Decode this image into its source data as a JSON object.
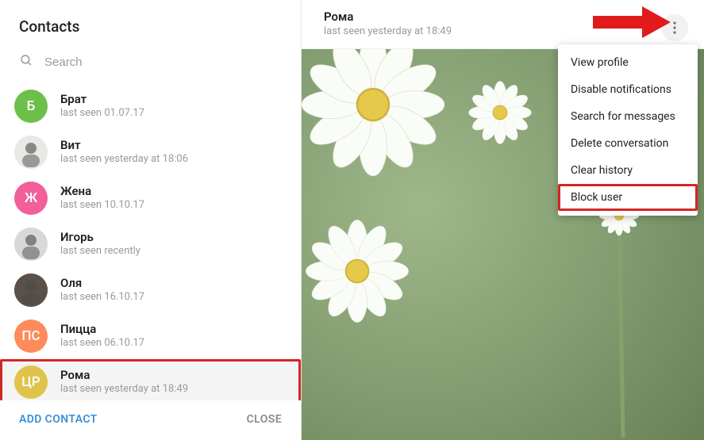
{
  "sidebar": {
    "title": "Contacts",
    "search_placeholder": "Search",
    "contacts": [
      {
        "name": "Брат",
        "status": "last seen 01.07.17",
        "avatar_kind": "letter",
        "avatar_text": "Б",
        "avatar_bg": "#6cc04a"
      },
      {
        "name": "Вит",
        "status": "last seen yesterday at 18:06",
        "avatar_kind": "photo",
        "avatar_text": "",
        "avatar_bg": "#e9e8e6"
      },
      {
        "name": "Жена",
        "status": "last seen 10.10.17",
        "avatar_kind": "letter",
        "avatar_text": "Ж",
        "avatar_bg": "#f25f9a"
      },
      {
        "name": "Игорь",
        "status": "last seen recently",
        "avatar_kind": "photo",
        "avatar_text": "",
        "avatar_bg": "#d9d8d6"
      },
      {
        "name": "Оля",
        "status": "last seen 16.10.17",
        "avatar_kind": "photo",
        "avatar_text": "",
        "avatar_bg": "#5a504a"
      },
      {
        "name": "Пицца",
        "status": "last seen 06.10.17",
        "avatar_kind": "letter",
        "avatar_text": "ПС",
        "avatar_bg": "#ff8a5c"
      },
      {
        "name": "Рома",
        "status": "last seen yesterday at 18:49",
        "avatar_kind": "letter",
        "avatar_text": "ЦР",
        "avatar_bg": "#e0c34a"
      }
    ],
    "selected_index": 6,
    "add_contact_label": "ADD CONTACT",
    "close_label": "CLOSE"
  },
  "chat": {
    "title": "Рома",
    "subtitle": "last seen yesterday at 18:49"
  },
  "menu": {
    "items": [
      "View profile",
      "Disable notifications",
      "Search for messages",
      "Delete conversation",
      "Clear history",
      "Block user"
    ],
    "highlighted_index": 5
  },
  "annotation": {
    "arrow_color": "#e11b1b",
    "highlight_color": "#d52626"
  }
}
